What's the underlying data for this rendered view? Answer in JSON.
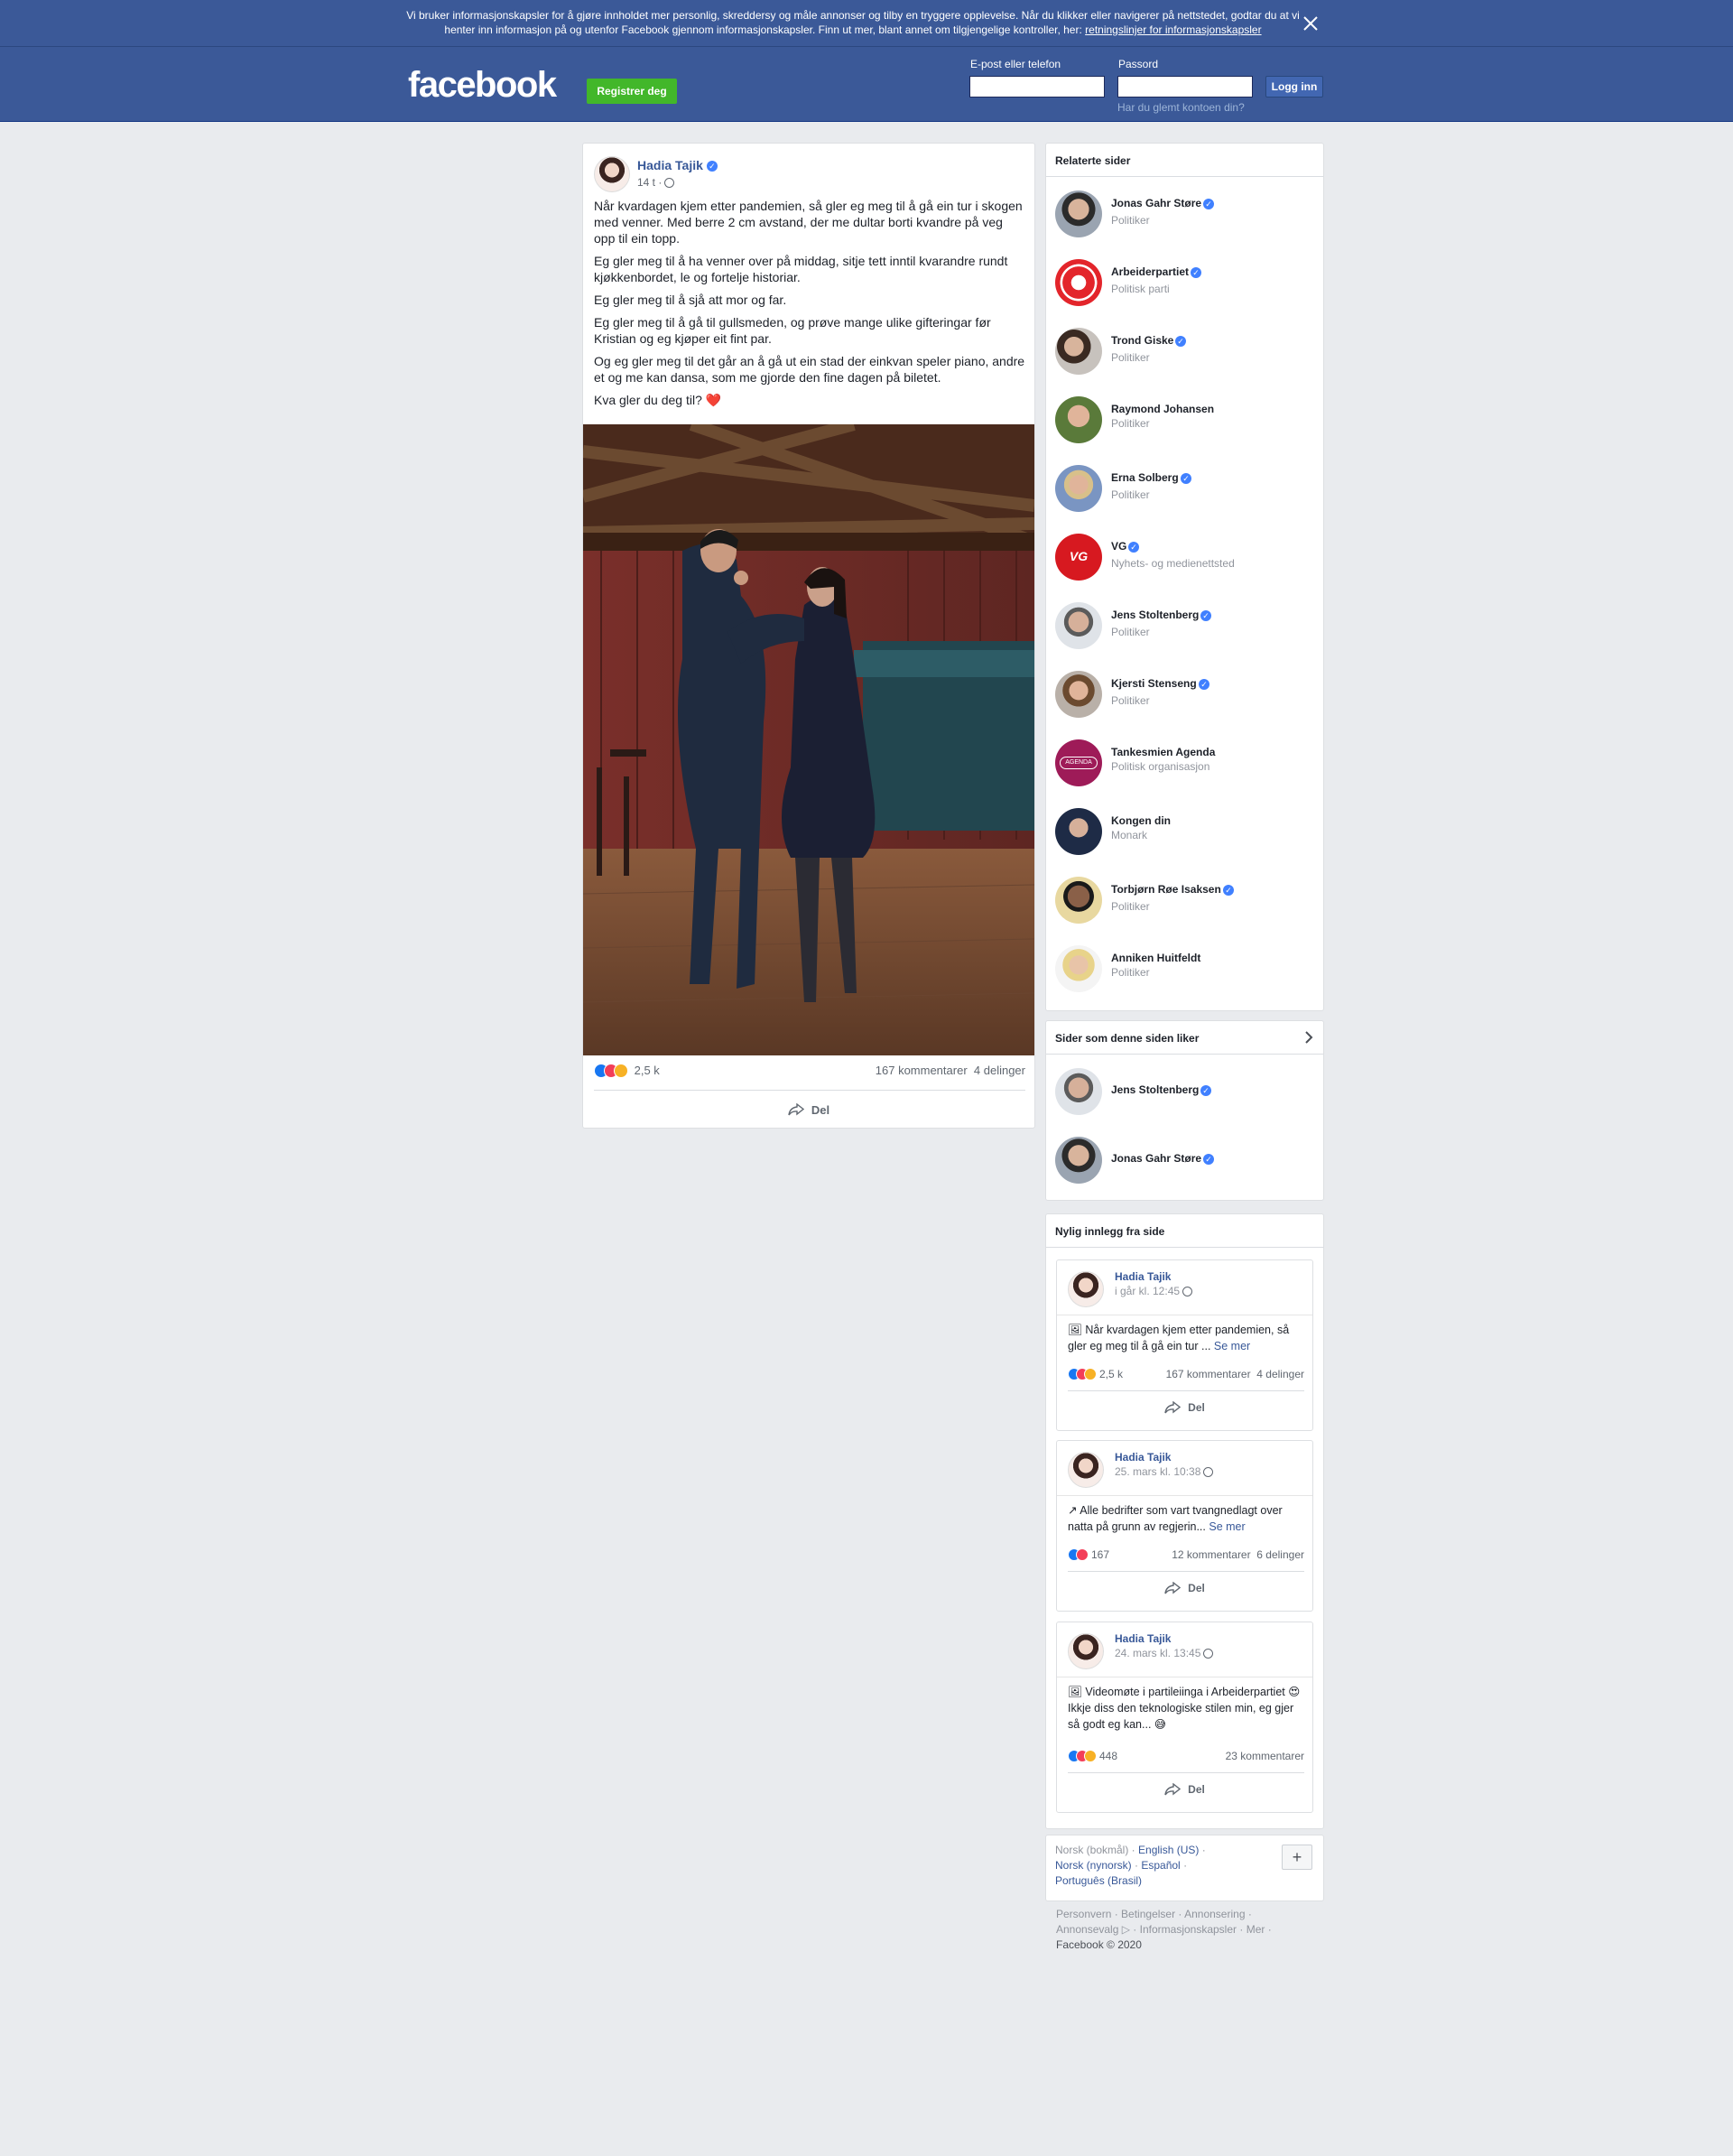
{
  "cookie_banner": {
    "text": "Vi bruker informasjonskapsler for å gjøre innholdet mer personlig, skreddersy og måle annonser og tilby en tryggere opplevelse. Når du klikker eller navigerer på nettstedet, godtar du at vi henter inn informasjon på og utenfor Facebook gjennom informasjonskapsler. Finn ut mer, blant annet om tilgjengelige kontroller, her: ",
    "link": "retningslinjer for informasjonskapsler",
    "close_icon": "close-icon"
  },
  "header": {
    "logo": "facebook",
    "register_label": "Registrer deg",
    "email_label": "E-post eller telefon",
    "password_label": "Passord",
    "login_label": "Logg inn",
    "forgot_label": "Har du glemt kontoen din?"
  },
  "post": {
    "author": "Hadia Tajik",
    "time": "14 t ·",
    "paragraphs": [
      "Når kvardagen kjem etter pandemien, så gler eg meg til å gå ein tur i skogen med venner. Med berre 2 cm avstand, der me dultar borti kvandre på veg opp til ein topp.",
      "Eg gler meg til å ha venner over på middag, sitje tett inntil kvarandre rundt kjøkkenbordet, le og fortelje historiar.",
      "Eg gler meg til å sjå att mor og far.",
      "Eg gler meg til å gå til gullsmeden, og prøve mange ulike gifteringar før Kristian og eg kjøper eit fint par.",
      "Og eg gler meg til det går an å gå ut ein stad der einkvan speler piano, andre et og me kan dansa, som me gjorde den fine dagen på biletet.",
      "Kva gler du deg til? ❤️"
    ],
    "reactions": "2,5 k",
    "comments": "167 kommentarer",
    "shares": "4 delinger",
    "share_label": "Del"
  },
  "related": {
    "title": "Relaterte sider",
    "items": [
      {
        "name": "Jonas Gahr Støre",
        "sub": "Politiker",
        "verified": true
      },
      {
        "name": "Arbeiderpartiet",
        "sub": "Politisk parti",
        "verified": true
      },
      {
        "name": "Trond Giske",
        "sub": "Politiker",
        "verified": true
      },
      {
        "name": "Raymond Johansen",
        "sub": "Politiker",
        "verified": false
      },
      {
        "name": "Erna Solberg",
        "sub": "Politiker",
        "verified": true
      },
      {
        "name": "VG",
        "sub": "Nyhets- og medienettsted",
        "verified": true
      },
      {
        "name": "Jens Stoltenberg",
        "sub": "Politiker",
        "verified": true
      },
      {
        "name": "Kjersti Stenseng",
        "sub": "Politiker",
        "verified": true
      },
      {
        "name": "Tankesmien Agenda",
        "sub": "Politisk organisasjon",
        "verified": false
      },
      {
        "name": "Kongen din",
        "sub": "Monark",
        "verified": false
      },
      {
        "name": "Torbjørn Røe Isaksen",
        "sub": "Politiker",
        "verified": true
      },
      {
        "name": "Anniken Huitfeldt",
        "sub": "Politiker",
        "verified": false
      }
    ]
  },
  "likes": {
    "title": "Sider som denne siden liker",
    "items": [
      {
        "name": "Jens Stoltenberg"
      },
      {
        "name": "Jonas Gahr Støre"
      }
    ]
  },
  "recent": {
    "title": "Nylig innlegg fra side",
    "posts": [
      {
        "author": "Hadia Tajik",
        "time": "i går kl. 12:45",
        "text": "🖼 Når kvardagen kjem etter pandemien, så gler eg meg til å gå ein tur ...",
        "more": "Se mer",
        "reactions": "2,5 k",
        "comments": "167 kommentarer",
        "shares": "4 delinger",
        "share_label": "Del"
      },
      {
        "author": "Hadia Tajik",
        "time": "25. mars kl. 10:38",
        "text": "↗ Alle bedrifter som vart tvangnedlagt over natta på grunn av regjerin...",
        "more": "Se mer",
        "reactions": "167",
        "comments": "12 kommentarer",
        "shares": "6 delinger",
        "share_label": "Del"
      },
      {
        "author": "Hadia Tajik",
        "time": "24. mars kl. 13:45",
        "text": "🖼 Videomøte i partileiinga i Arbeiderpartiet 😍 Ikkje diss den teknologiske stilen min, eg gjer så godt eg kan... 😅",
        "more": "",
        "reactions": "448",
        "comments": "23 kommentarer",
        "shares": "",
        "share_label": "Del"
      }
    ]
  },
  "languages": {
    "current": "Norsk (bokmål) · ",
    "links": [
      "English (US)",
      "Norsk (nynorsk)",
      "Español",
      "Português (Brasil)"
    ],
    "plus": "+"
  },
  "footer": {
    "links": [
      "Personvern",
      "Betingelser",
      "Annonsering",
      "Annonsevalg",
      "Informasjonskapsler",
      "Mer"
    ],
    "copyright": "Facebook © 2020"
  }
}
